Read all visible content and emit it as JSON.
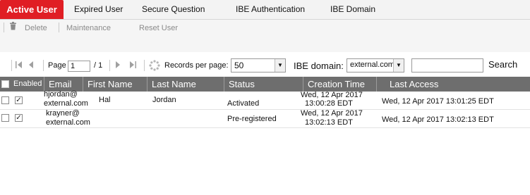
{
  "tabs": [
    "Active User",
    "Expired User",
    "Secure Question",
    "IBE Authentication",
    "IBE Domain"
  ],
  "toolbar": {
    "delete_label": "Delete",
    "maintenance_label": "Maintenance",
    "reset_user_label": "Reset User"
  },
  "pager": {
    "page_label": "Page",
    "page_value": "1",
    "page_total": "/ 1",
    "records_label": "Records per page:",
    "records_value": "50",
    "domain_label": "IBE domain:",
    "domain_value": "external.com",
    "search_value": "",
    "search_label": "Search"
  },
  "grid": {
    "columns": [
      "Enabled",
      "Email",
      "First Name",
      "Last Name",
      "Status",
      "Creation Time",
      "Last Access"
    ],
    "rows": [
      {
        "email_line1": "hjordan@",
        "email_line2": "external.com",
        "first_name": "Hal",
        "last_name": "Jordan",
        "status": "Activated",
        "created_line1": "Wed, 12 Apr 2017",
        "created_line2": "13:00:28 EDT",
        "last_access": "Wed, 12 Apr 2017 13:01:25 EDT"
      },
      {
        "email_line1": "krayner@",
        "email_line2": "external.com",
        "first_name": "",
        "last_name": "",
        "status": "Pre-registered",
        "created_line1": "Wed, 12 Apr 2017",
        "created_line2": "13:02:13 EDT",
        "last_access": "Wed, 12 Apr 2017 13:02:13 EDT"
      }
    ]
  },
  "colors": {
    "accent": "#e01e24",
    "header_bg": "#6e6e6e"
  },
  "icons": [
    "trash-icon",
    "refresh-icon",
    "first-page-icon",
    "prev-page-icon",
    "next-page-icon",
    "last-page-icon",
    "loading-icon",
    "chevron-down-icon",
    "check-icon"
  ]
}
